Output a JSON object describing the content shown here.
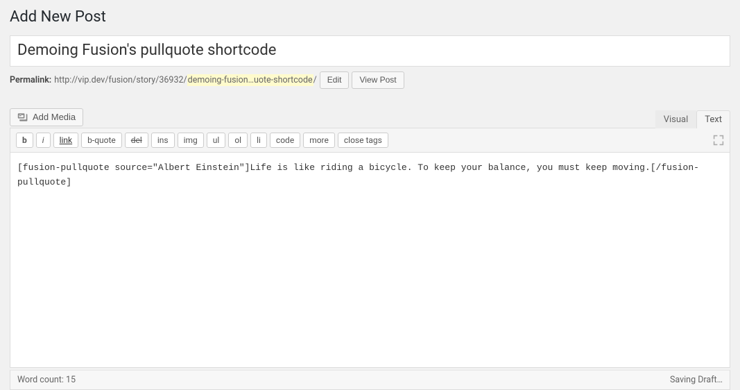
{
  "page": {
    "title": "Add New Post"
  },
  "post": {
    "title_value": "Demoing Fusion's pullquote shortcode",
    "content": "[fusion-pullquote source=\"Albert Einstein\"]Life is like riding a bicycle. To keep your balance, you must keep moving.[/fusion-pullquote]"
  },
  "permalink": {
    "label": "Permalink:",
    "base_url": "http://vip.dev/fusion/story/36932/",
    "slug": "demoing-fusion…uote-shortcode",
    "slug_trailing": "/",
    "edit_label": "Edit",
    "view_post_label": "View Post"
  },
  "media_button": {
    "label": "Add Media"
  },
  "tabs": {
    "visual": "Visual",
    "text": "Text"
  },
  "toolbar": {
    "b": "b",
    "i": "i",
    "link": "link",
    "bquote": "b-quote",
    "del": "del",
    "ins": "ins",
    "img": "img",
    "ul": "ul",
    "ol": "ol",
    "li": "li",
    "code": "code",
    "more": "more",
    "close_tags": "close tags"
  },
  "statusbar": {
    "word_count_label": "Word count:",
    "word_count_value": "15",
    "save_status": "Saving Draft…"
  }
}
